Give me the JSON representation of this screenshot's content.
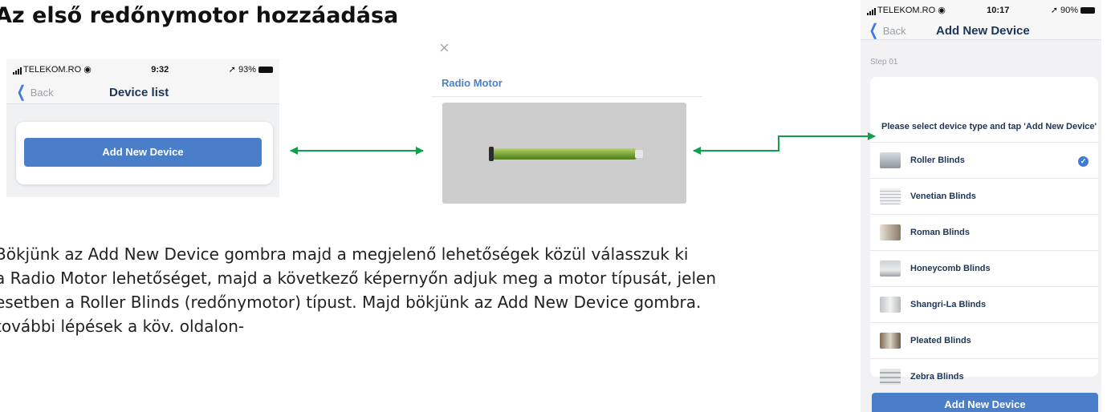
{
  "title": "Az első redőnymotor hozzáadása",
  "paragraph": [
    "Bökjünk az Add New Device gombra majd a megjelenő lehetőségek közül válasszuk ki",
    "a Radio Motor lehetőséget, majd a következő képernyőn adjuk meg a motor típusát, jelen",
    "esetben a Roller Blinds (redőnymotor) típust. Majd bökjünk az Add New Device gombra.",
    "további lépések a köv. oldalon-"
  ],
  "screen1": {
    "carrier": "TELEKOM.RO",
    "time": "9:32",
    "battery": "93%",
    "back": "Back",
    "nav_title": "Device list",
    "button": "Add New Device"
  },
  "screen2": {
    "close_glyph": "×",
    "label": "Radio Motor"
  },
  "screen3": {
    "carrier": "TELEKOM.RO",
    "time": "10:17",
    "battery": "90%",
    "back": "Back",
    "nav_title": "Add New Device",
    "step": "Step 01",
    "instruction": "Please select device type and tap 'Add New Device'",
    "options": [
      {
        "label": "Roller Blinds",
        "selected": true
      },
      {
        "label": "Venetian Blinds",
        "selected": false
      },
      {
        "label": "Roman Blinds",
        "selected": false
      },
      {
        "label": "Honeycomb Blinds",
        "selected": false
      },
      {
        "label": "Shangri-La Blinds",
        "selected": false
      },
      {
        "label": "Pleated Blinds",
        "selected": false
      },
      {
        "label": "Zebra Blinds",
        "selected": false
      }
    ],
    "button": "Add New Device"
  },
  "colors": {
    "accent_blue": "#4a7ec9",
    "arrow_green": "#0fa14a",
    "nav_title": "#1d3557"
  }
}
